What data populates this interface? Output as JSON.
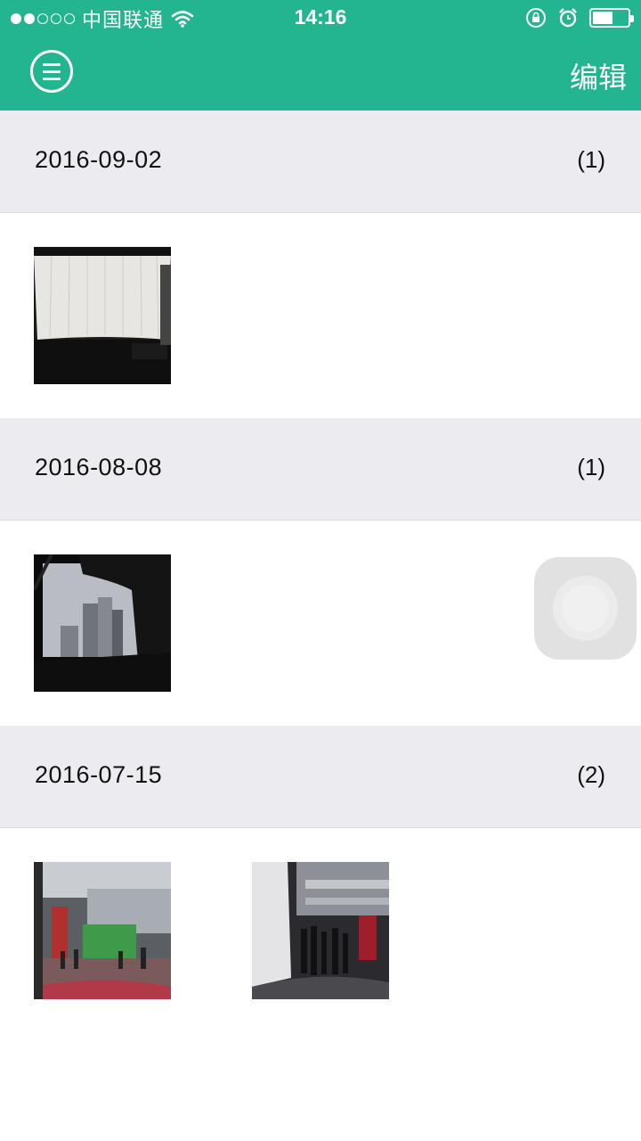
{
  "status_bar": {
    "carrier": "中国联通",
    "time": "14:16",
    "icons": [
      "signal-dots-icon",
      "wifi-icon",
      "rotation-lock-icon",
      "alarm-icon",
      "battery-icon"
    ]
  },
  "header": {
    "menu_icon": "menu-icon",
    "edit_label": "编辑",
    "accent_color": "#22b58f"
  },
  "sections": [
    {
      "date": "2016-09-02",
      "count": "(1)"
    },
    {
      "date": "2016-08-08",
      "count": "(1)"
    },
    {
      "date": "2016-07-15",
      "count": "(2)"
    }
  ]
}
